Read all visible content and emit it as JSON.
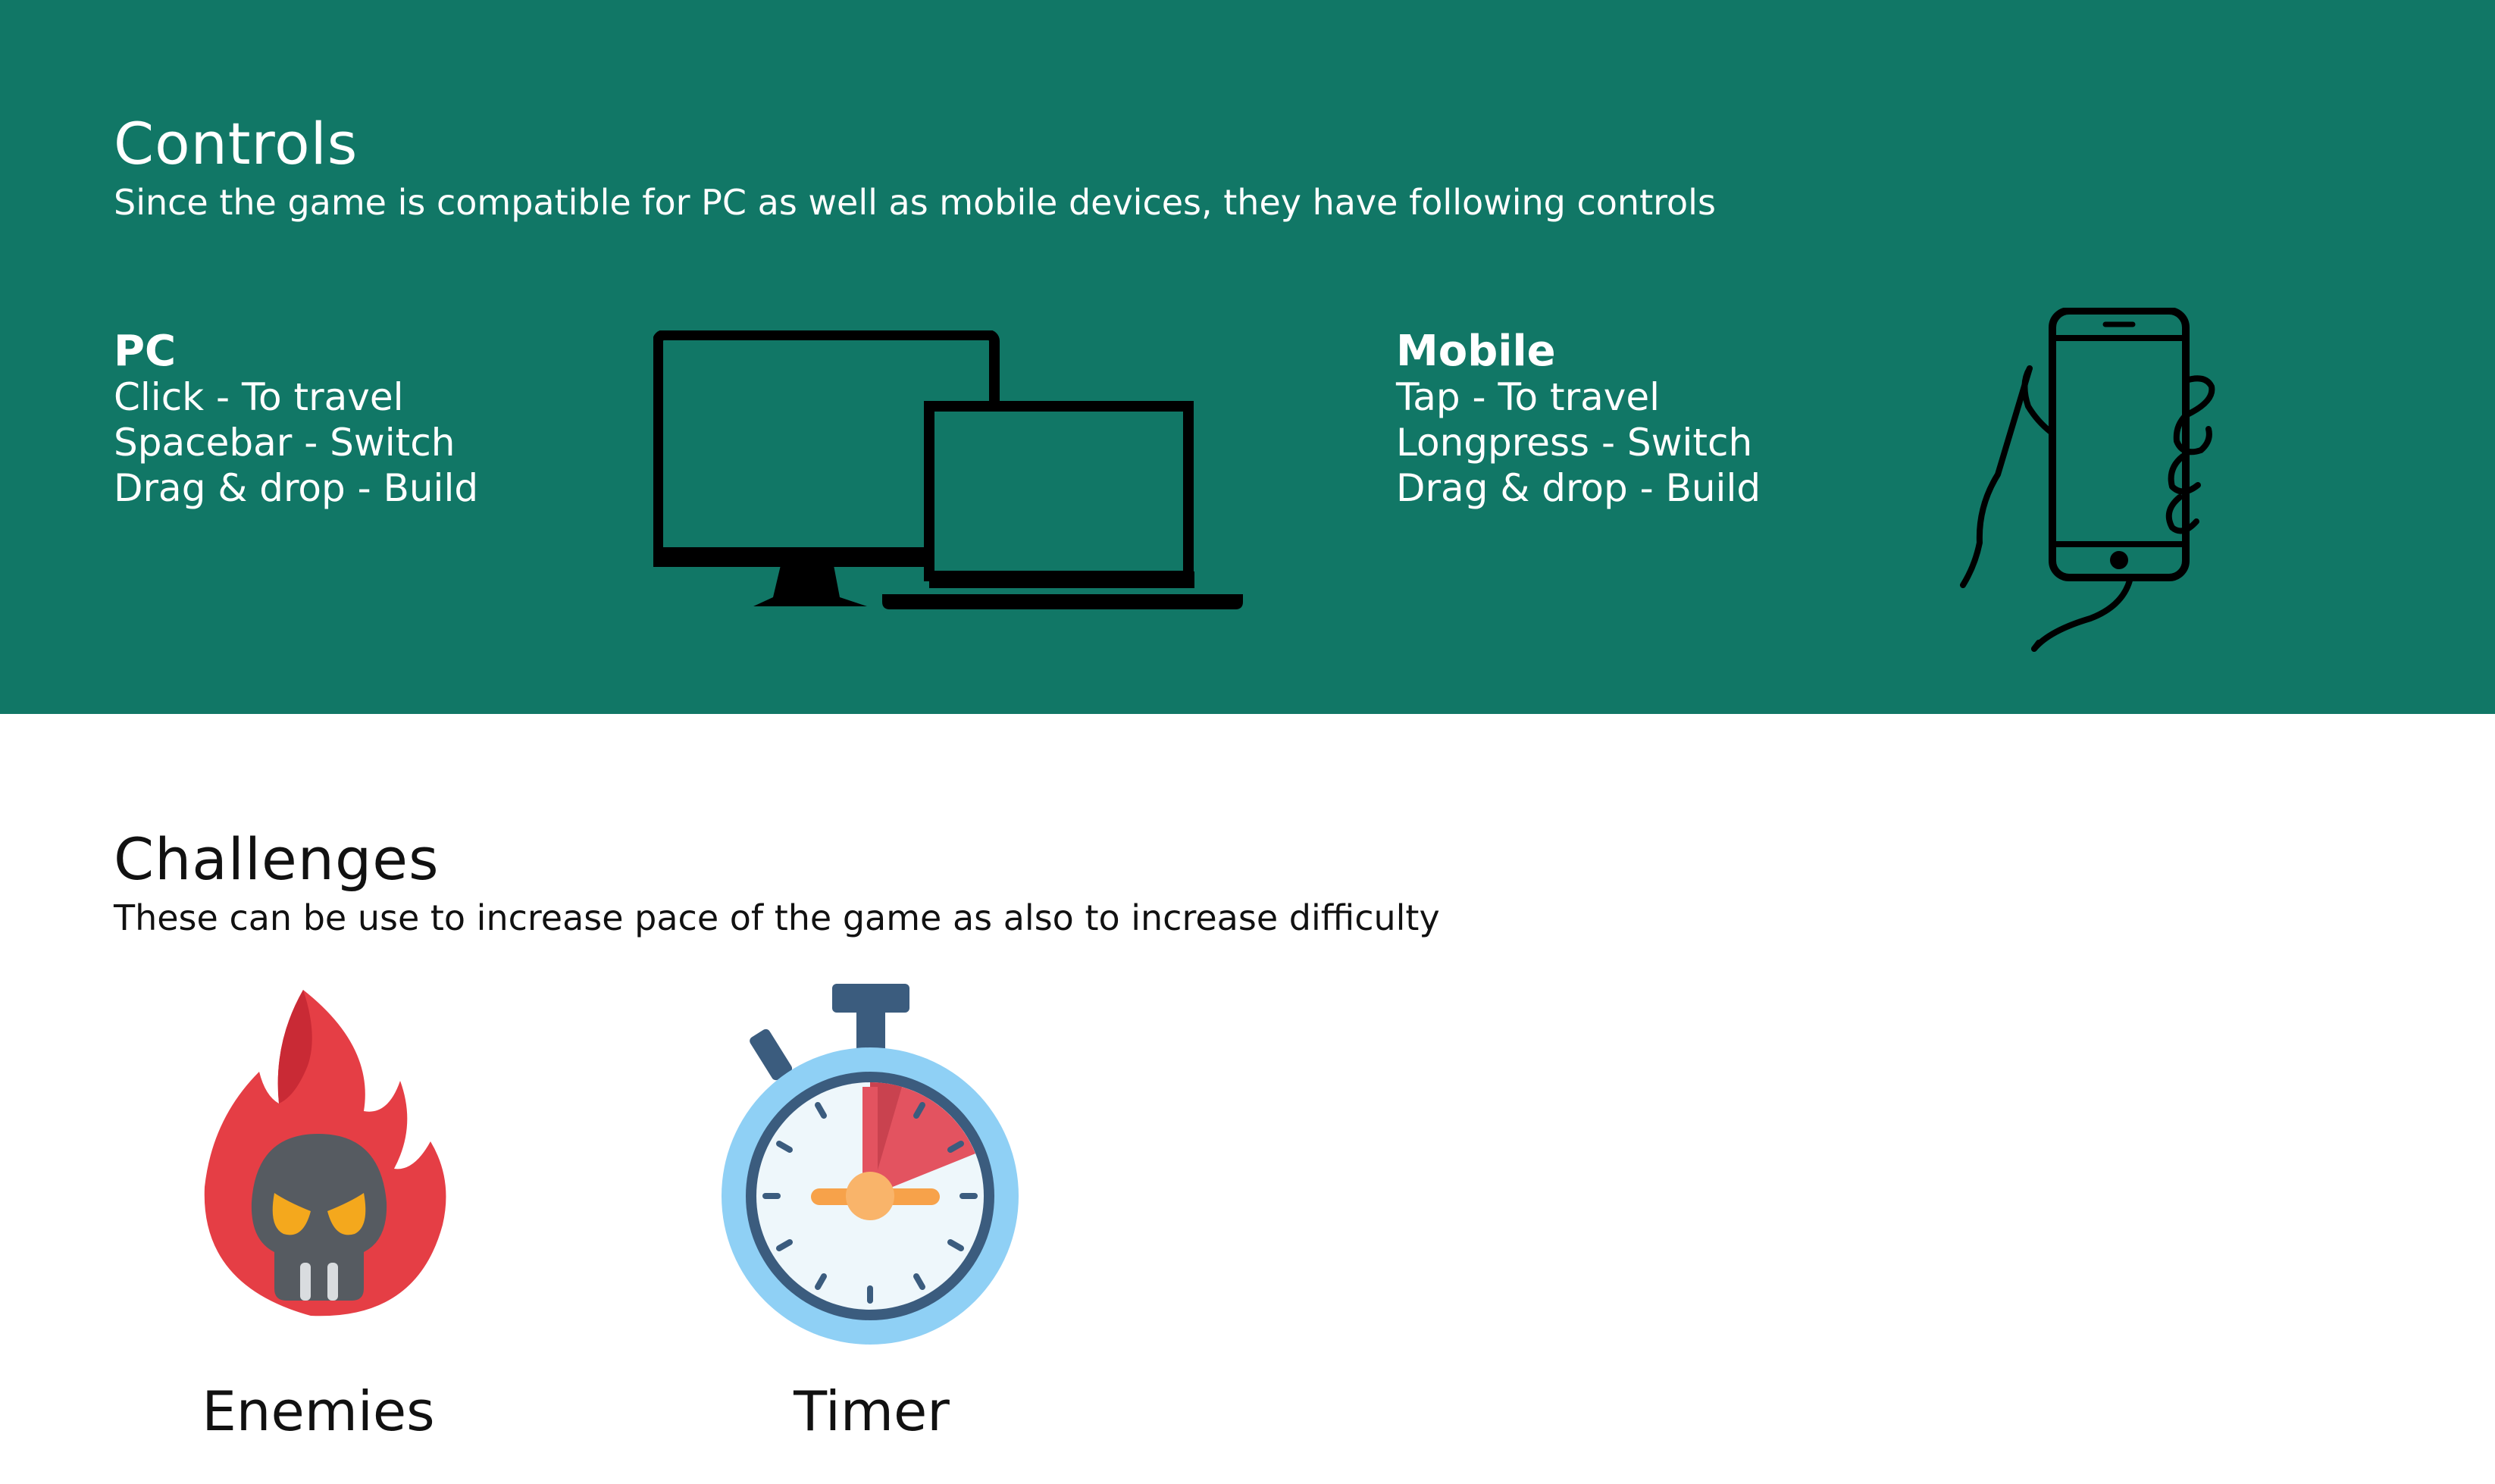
{
  "colors": {
    "band": "#117766",
    "band_text": "#ffffff",
    "body_text": "#111111",
    "icon_black": "#000000",
    "flame_red": "#e53e45",
    "flame_dark": "#c92a35",
    "skull_gray": "#565b61",
    "skull_eyes": "#f4a81d",
    "timer_ring": "#8fd0f5",
    "timer_face": "#eef7fb",
    "timer_rim": "#3b5c7e",
    "timer_sector": "#e35360",
    "timer_hands": "#f7a24a"
  },
  "controls": {
    "title": "Controls",
    "subtitle": "Since the game is compatible for PC as well as mobile devices, they have following controls",
    "pc": {
      "heading": "PC",
      "items": [
        "Click - To travel",
        "Spacebar - Switch",
        "Drag & drop - Build"
      ],
      "icon": "desktop-laptop-icon"
    },
    "mobile": {
      "heading": "Mobile",
      "items": [
        "Tap - To travel",
        "Longpress - Switch",
        "Drag & drop - Build"
      ],
      "icon": "hand-phone-icon"
    }
  },
  "challenges": {
    "title": "Challenges",
    "subtitle": "These can be use to increase pace of the game as also to increase difficulty",
    "items": [
      {
        "label": "Enemies",
        "icon": "flaming-skull-icon"
      },
      {
        "label": "Timer",
        "icon": "stopwatch-icon"
      }
    ]
  }
}
